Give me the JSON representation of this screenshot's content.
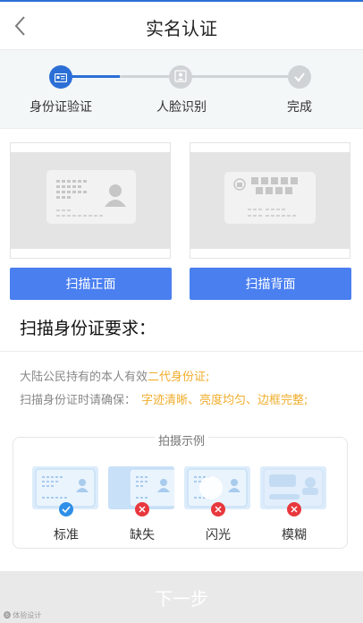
{
  "header": {
    "title": "实名认证",
    "back_icon": "back-chevron-icon"
  },
  "stepper": {
    "active_color": "#2b6fd6",
    "inactive_color": "#d0d3d6",
    "steps": [
      {
        "label": "身份证验证",
        "icon": "id-card-icon",
        "state": "active"
      },
      {
        "label": "人脸识别",
        "icon": "face-icon",
        "state": "pending"
      },
      {
        "label": "完成",
        "icon": "check-icon",
        "state": "pending"
      }
    ]
  },
  "scan": {
    "front_label": "扫描正面",
    "back_label": "扫描背面",
    "button_color": "#4a7ff0"
  },
  "requirements": {
    "title": "扫描身份证要求：",
    "line1_prefix": "大陆公民持有的本人有效",
    "line1_highlight": "二代身份证;",
    "line2_prefix": "扫描身份证时请确保：",
    "line2_highlight": "字迹清晰、亮度均匀、边框完整;",
    "highlight_color": "#f0ad2c"
  },
  "examples": {
    "title": "拍摄示例",
    "items": [
      {
        "label": "标准",
        "status": "ok",
        "icon": "check-circle-icon"
      },
      {
        "label": "缺失",
        "status": "error",
        "icon": "x-circle-icon"
      },
      {
        "label": "闪光",
        "status": "error",
        "icon": "x-circle-icon"
      },
      {
        "label": "模糊",
        "status": "error",
        "icon": "x-circle-icon"
      }
    ]
  },
  "footer": {
    "next_label": "下一步"
  },
  "watermark": "🅑 体验设计"
}
